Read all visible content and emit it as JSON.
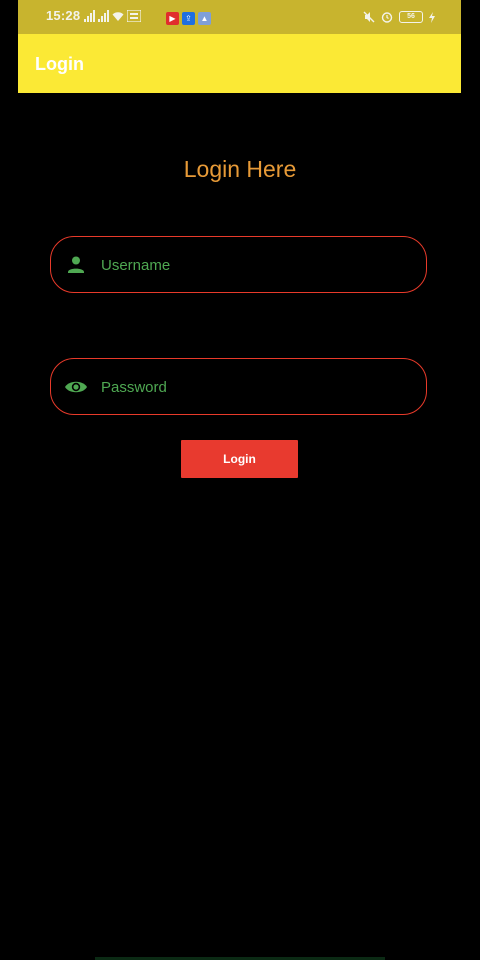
{
  "status_bar": {
    "time": "15:28",
    "battery": "56",
    "icons": [
      "signal-icon",
      "signal-icon",
      "wifi-icon",
      "volte-icon",
      "youtube-app-icon",
      "share-app-icon",
      "image-app-icon",
      "mute-icon",
      "alarm-icon",
      "battery-icon",
      "charging-icon"
    ]
  },
  "app_bar": {
    "title": "Login"
  },
  "main": {
    "heading": "Login Here",
    "username": {
      "placeholder": "Username",
      "value": ""
    },
    "password": {
      "placeholder": "Password",
      "value": ""
    },
    "login_button_label": "Login"
  },
  "colors": {
    "app_bar": "#fbe935",
    "status_bar": "#c8b42e",
    "heading": "#e79a37",
    "field_border": "#e83a2a",
    "field_text": "#4fa852",
    "button": "#e83a2f",
    "background": "#000000"
  }
}
